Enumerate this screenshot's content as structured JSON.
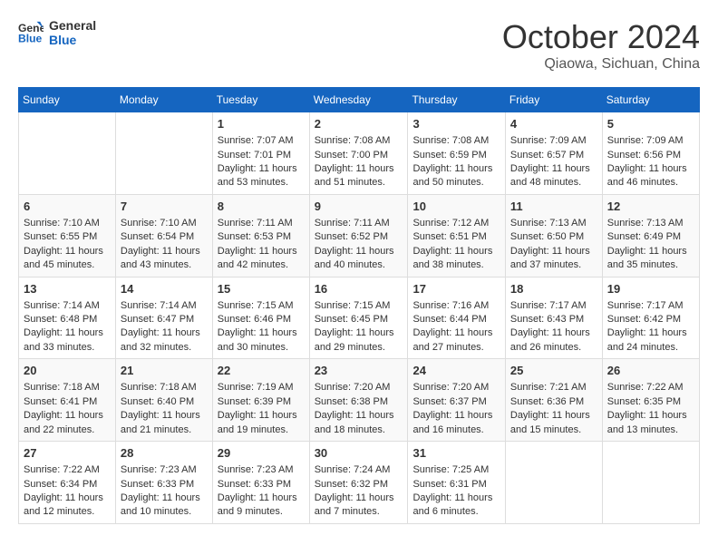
{
  "header": {
    "logo_line1": "General",
    "logo_line2": "Blue",
    "month": "October 2024",
    "location": "Qiaowa, Sichuan, China"
  },
  "days_of_week": [
    "Sunday",
    "Monday",
    "Tuesday",
    "Wednesday",
    "Thursday",
    "Friday",
    "Saturday"
  ],
  "weeks": [
    [
      {
        "day": "",
        "sunrise": "",
        "sunset": "",
        "daylight": ""
      },
      {
        "day": "",
        "sunrise": "",
        "sunset": "",
        "daylight": ""
      },
      {
        "day": "1",
        "sunrise": "Sunrise: 7:07 AM",
        "sunset": "Sunset: 7:01 PM",
        "daylight": "Daylight: 11 hours and 53 minutes."
      },
      {
        "day": "2",
        "sunrise": "Sunrise: 7:08 AM",
        "sunset": "Sunset: 7:00 PM",
        "daylight": "Daylight: 11 hours and 51 minutes."
      },
      {
        "day": "3",
        "sunrise": "Sunrise: 7:08 AM",
        "sunset": "Sunset: 6:59 PM",
        "daylight": "Daylight: 11 hours and 50 minutes."
      },
      {
        "day": "4",
        "sunrise": "Sunrise: 7:09 AM",
        "sunset": "Sunset: 6:57 PM",
        "daylight": "Daylight: 11 hours and 48 minutes."
      },
      {
        "day": "5",
        "sunrise": "Sunrise: 7:09 AM",
        "sunset": "Sunset: 6:56 PM",
        "daylight": "Daylight: 11 hours and 46 minutes."
      }
    ],
    [
      {
        "day": "6",
        "sunrise": "Sunrise: 7:10 AM",
        "sunset": "Sunset: 6:55 PM",
        "daylight": "Daylight: 11 hours and 45 minutes."
      },
      {
        "day": "7",
        "sunrise": "Sunrise: 7:10 AM",
        "sunset": "Sunset: 6:54 PM",
        "daylight": "Daylight: 11 hours and 43 minutes."
      },
      {
        "day": "8",
        "sunrise": "Sunrise: 7:11 AM",
        "sunset": "Sunset: 6:53 PM",
        "daylight": "Daylight: 11 hours and 42 minutes."
      },
      {
        "day": "9",
        "sunrise": "Sunrise: 7:11 AM",
        "sunset": "Sunset: 6:52 PM",
        "daylight": "Daylight: 11 hours and 40 minutes."
      },
      {
        "day": "10",
        "sunrise": "Sunrise: 7:12 AM",
        "sunset": "Sunset: 6:51 PM",
        "daylight": "Daylight: 11 hours and 38 minutes."
      },
      {
        "day": "11",
        "sunrise": "Sunrise: 7:13 AM",
        "sunset": "Sunset: 6:50 PM",
        "daylight": "Daylight: 11 hours and 37 minutes."
      },
      {
        "day": "12",
        "sunrise": "Sunrise: 7:13 AM",
        "sunset": "Sunset: 6:49 PM",
        "daylight": "Daylight: 11 hours and 35 minutes."
      }
    ],
    [
      {
        "day": "13",
        "sunrise": "Sunrise: 7:14 AM",
        "sunset": "Sunset: 6:48 PM",
        "daylight": "Daylight: 11 hours and 33 minutes."
      },
      {
        "day": "14",
        "sunrise": "Sunrise: 7:14 AM",
        "sunset": "Sunset: 6:47 PM",
        "daylight": "Daylight: 11 hours and 32 minutes."
      },
      {
        "day": "15",
        "sunrise": "Sunrise: 7:15 AM",
        "sunset": "Sunset: 6:46 PM",
        "daylight": "Daylight: 11 hours and 30 minutes."
      },
      {
        "day": "16",
        "sunrise": "Sunrise: 7:15 AM",
        "sunset": "Sunset: 6:45 PM",
        "daylight": "Daylight: 11 hours and 29 minutes."
      },
      {
        "day": "17",
        "sunrise": "Sunrise: 7:16 AM",
        "sunset": "Sunset: 6:44 PM",
        "daylight": "Daylight: 11 hours and 27 minutes."
      },
      {
        "day": "18",
        "sunrise": "Sunrise: 7:17 AM",
        "sunset": "Sunset: 6:43 PM",
        "daylight": "Daylight: 11 hours and 26 minutes."
      },
      {
        "day": "19",
        "sunrise": "Sunrise: 7:17 AM",
        "sunset": "Sunset: 6:42 PM",
        "daylight": "Daylight: 11 hours and 24 minutes."
      }
    ],
    [
      {
        "day": "20",
        "sunrise": "Sunrise: 7:18 AM",
        "sunset": "Sunset: 6:41 PM",
        "daylight": "Daylight: 11 hours and 22 minutes."
      },
      {
        "day": "21",
        "sunrise": "Sunrise: 7:18 AM",
        "sunset": "Sunset: 6:40 PM",
        "daylight": "Daylight: 11 hours and 21 minutes."
      },
      {
        "day": "22",
        "sunrise": "Sunrise: 7:19 AM",
        "sunset": "Sunset: 6:39 PM",
        "daylight": "Daylight: 11 hours and 19 minutes."
      },
      {
        "day": "23",
        "sunrise": "Sunrise: 7:20 AM",
        "sunset": "Sunset: 6:38 PM",
        "daylight": "Daylight: 11 hours and 18 minutes."
      },
      {
        "day": "24",
        "sunrise": "Sunrise: 7:20 AM",
        "sunset": "Sunset: 6:37 PM",
        "daylight": "Daylight: 11 hours and 16 minutes."
      },
      {
        "day": "25",
        "sunrise": "Sunrise: 7:21 AM",
        "sunset": "Sunset: 6:36 PM",
        "daylight": "Daylight: 11 hours and 15 minutes."
      },
      {
        "day": "26",
        "sunrise": "Sunrise: 7:22 AM",
        "sunset": "Sunset: 6:35 PM",
        "daylight": "Daylight: 11 hours and 13 minutes."
      }
    ],
    [
      {
        "day": "27",
        "sunrise": "Sunrise: 7:22 AM",
        "sunset": "Sunset: 6:34 PM",
        "daylight": "Daylight: 11 hours and 12 minutes."
      },
      {
        "day": "28",
        "sunrise": "Sunrise: 7:23 AM",
        "sunset": "Sunset: 6:33 PM",
        "daylight": "Daylight: 11 hours and 10 minutes."
      },
      {
        "day": "29",
        "sunrise": "Sunrise: 7:23 AM",
        "sunset": "Sunset: 6:33 PM",
        "daylight": "Daylight: 11 hours and 9 minutes."
      },
      {
        "day": "30",
        "sunrise": "Sunrise: 7:24 AM",
        "sunset": "Sunset: 6:32 PM",
        "daylight": "Daylight: 11 hours and 7 minutes."
      },
      {
        "day": "31",
        "sunrise": "Sunrise: 7:25 AM",
        "sunset": "Sunset: 6:31 PM",
        "daylight": "Daylight: 11 hours and 6 minutes."
      },
      {
        "day": "",
        "sunrise": "",
        "sunset": "",
        "daylight": ""
      },
      {
        "day": "",
        "sunrise": "",
        "sunset": "",
        "daylight": ""
      }
    ]
  ]
}
